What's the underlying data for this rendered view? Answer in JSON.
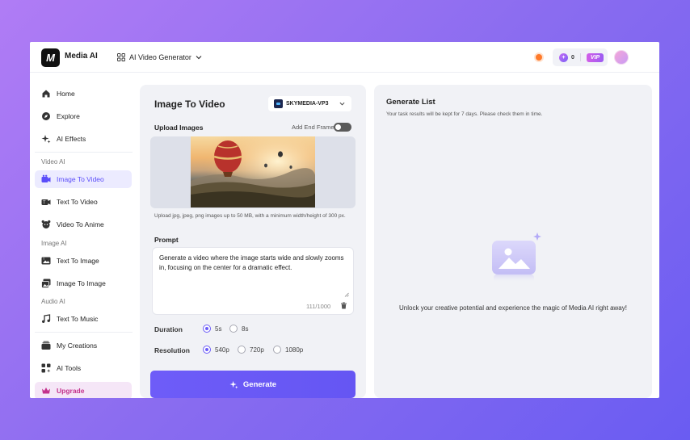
{
  "header": {
    "logo_text": "M",
    "app_name": "Media AI",
    "tool_name": "AI Video Generator",
    "credits": "0",
    "vip_label": "VIP"
  },
  "sidebar": {
    "items_top": [
      {
        "label": "Home",
        "icon": "home-icon"
      },
      {
        "label": "Explore",
        "icon": "compass-icon"
      },
      {
        "label": "AI Effects",
        "icon": "sparkle-icon"
      }
    ],
    "section_video": "Video AI",
    "items_video": [
      {
        "label": "Image To Video",
        "icon": "image-video-icon",
        "active": true
      },
      {
        "label": "Text To Video",
        "icon": "text-video-icon"
      },
      {
        "label": "Video To Anime",
        "icon": "anime-icon"
      }
    ],
    "section_image": "Image AI",
    "items_image": [
      {
        "label": "Text To Image",
        "icon": "text-image-icon"
      },
      {
        "label": "Image To Image",
        "icon": "image-image-icon"
      }
    ],
    "section_audio": "Audio AI",
    "items_audio": [
      {
        "label": "Text To Music",
        "icon": "music-icon"
      }
    ],
    "items_bottom": [
      {
        "label": "My Creations",
        "icon": "creations-icon"
      },
      {
        "label": "AI Tools",
        "icon": "tools-icon"
      },
      {
        "label": "Upgrade",
        "icon": "crown-icon"
      }
    ]
  },
  "generator": {
    "title": "Image To Video",
    "model": "SKYMEDIA-VP3",
    "upload_label": "Upload Images",
    "end_frame_label": "Add End Frame",
    "end_frame_enabled": false,
    "upload_help": "Upload jpg, jpeg, png images up to 50 MB, with a minimum width/height of 300 px.",
    "prompt_label": "Prompt",
    "prompt_text": "Generate a video where the image starts wide and slowly zooms in, focusing on the center for a dramatic effect.",
    "char_count": "111/1000",
    "duration_label": "Duration",
    "duration_options": [
      "5s",
      "8s"
    ],
    "duration_selected": "5s",
    "resolution_label": "Resolution",
    "resolution_options": [
      "540p",
      "720p",
      "1080p"
    ],
    "resolution_selected": "540p",
    "generate_label": "Generate"
  },
  "generate_list": {
    "title": "Generate List",
    "subtitle": "Your task results will be kept for 7 days. Please check them in time.",
    "empty_text": "Unlock your creative potential and experience the magic of Media AI right away!"
  },
  "colors": {
    "accent": "#6b5bf8",
    "upgrade": "#c3328c",
    "background_gradient_start": "#b07cf5",
    "background_gradient_end": "#6a5cf2"
  }
}
